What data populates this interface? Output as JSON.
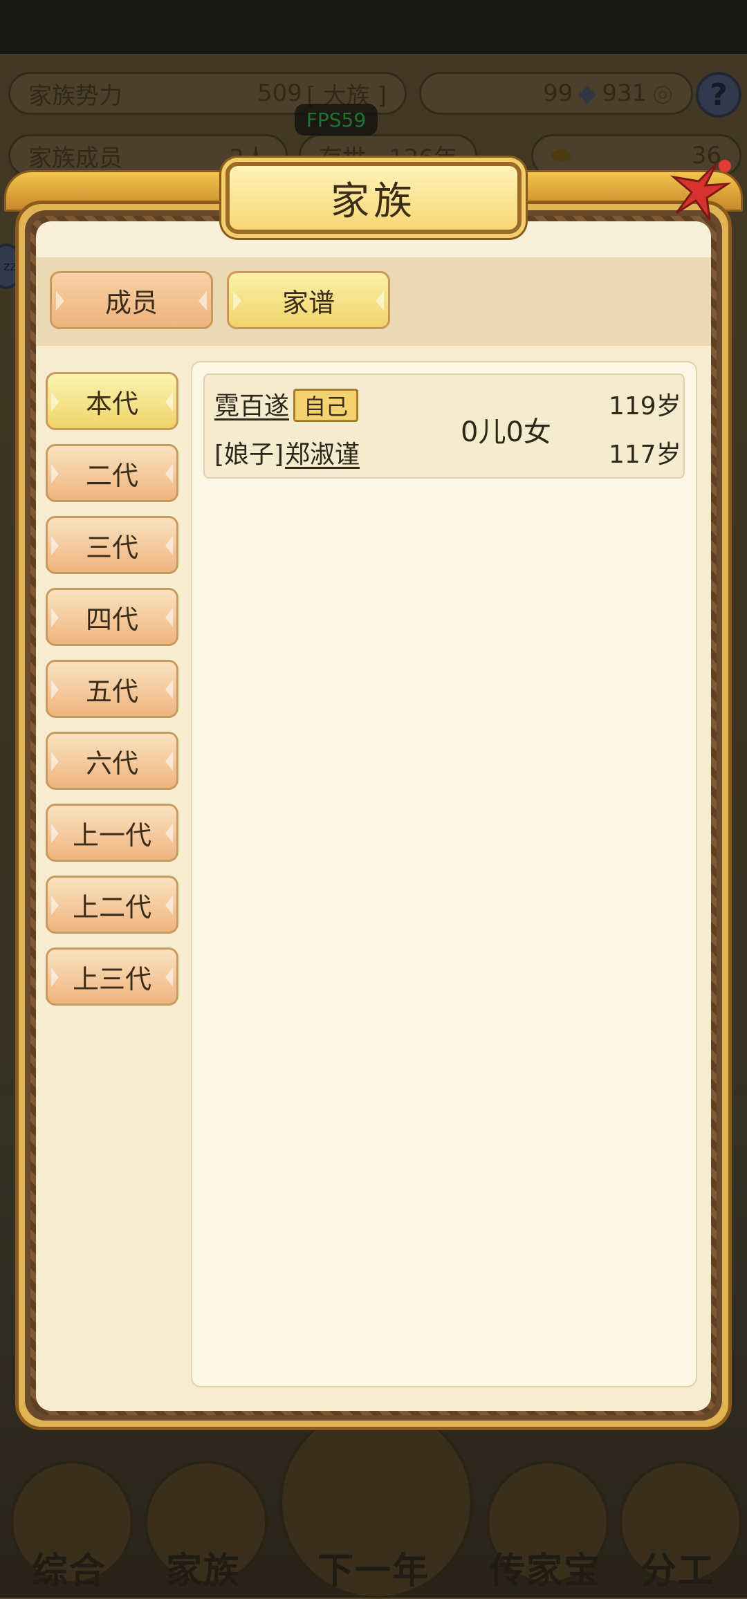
{
  "background": {
    "stats": {
      "family_power_label": "家族势力",
      "family_power_value": "509",
      "family_power_rank": "[ 大族 ]",
      "silver": "99",
      "copper": "931",
      "members_label": "家族成员",
      "members_value": "2人",
      "years_label": "存世",
      "years_value": "126年",
      "gold": "36"
    },
    "fps": "FPS59",
    "sleep_badge": "zz",
    "bottom_nav": [
      {
        "label": "综合"
      },
      {
        "label": "家族"
      },
      {
        "label": "下一年"
      },
      {
        "label": "传家宝"
      },
      {
        "label": "分工"
      }
    ]
  },
  "dialog": {
    "title": "家族",
    "tabs": [
      {
        "label": "成员",
        "selected": false
      },
      {
        "label": "家谱",
        "selected": true
      }
    ],
    "generations": [
      {
        "label": "本代",
        "selected": true
      },
      {
        "label": "二代",
        "selected": false
      },
      {
        "label": "三代",
        "selected": false
      },
      {
        "label": "四代",
        "selected": false
      },
      {
        "label": "五代",
        "selected": false
      },
      {
        "label": "六代",
        "selected": false
      },
      {
        "label": "上一代",
        "selected": false
      },
      {
        "label": "上二代",
        "selected": false
      },
      {
        "label": "上三代",
        "selected": false
      }
    ],
    "entries": [
      {
        "name": "霓百遂",
        "self_badge": "自己",
        "age": "119岁",
        "spouse_prefix": "[娘子]",
        "spouse_name": "郑淑谨",
        "spouse_age": "117岁",
        "children": "0儿0女"
      }
    ]
  },
  "colors": {
    "frame_gold": "#e0b353",
    "frame_brown": "#8a5a1c",
    "panel_cream": "#f7efd7",
    "tab_selected": "#f0d46a",
    "tab_unselected": "#eeb47e",
    "close_red": "#d8322e"
  }
}
